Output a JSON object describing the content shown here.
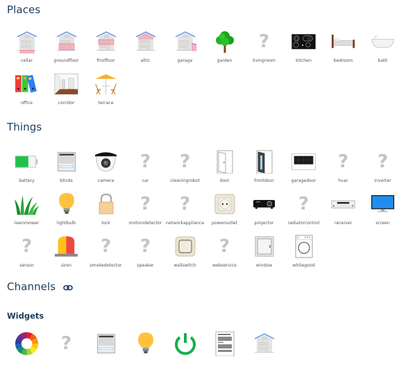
{
  "sections": {
    "places": {
      "title": "Places"
    },
    "things": {
      "title": "Things"
    },
    "channels": {
      "title": "Channels",
      "icon": "link-icon"
    },
    "widgets": {
      "title": "Widgets"
    }
  },
  "places": [
    {
      "label": "cellar",
      "icon": "house-cellar-icon"
    },
    {
      "label": "groundfloor",
      "icon": "house-groundfloor-icon"
    },
    {
      "label": "firstfloor",
      "icon": "house-firstfloor-icon"
    },
    {
      "label": "attic",
      "icon": "house-attic-icon"
    },
    {
      "label": "garage",
      "icon": "house-garage-icon"
    },
    {
      "label": "garden",
      "icon": "tree-icon"
    },
    {
      "label": "livingroom",
      "icon": "question-icon"
    },
    {
      "label": "kitchen",
      "icon": "cooktop-icon"
    },
    {
      "label": "bedroom",
      "icon": "bed-icon"
    },
    {
      "label": "bath",
      "icon": "bathtub-icon"
    },
    {
      "label": "office",
      "icon": "binders-icon"
    },
    {
      "label": "corridor",
      "icon": "corridor-icon"
    },
    {
      "label": "terrace",
      "icon": "terrace-icon"
    }
  ],
  "things": [
    {
      "label": "battery",
      "icon": "battery-icon"
    },
    {
      "label": "blinds",
      "icon": "blinds-icon"
    },
    {
      "label": "camera",
      "icon": "camera-icon"
    },
    {
      "label": "car",
      "icon": "question-icon"
    },
    {
      "label": "cleaningrobot",
      "icon": "question-icon"
    },
    {
      "label": "door",
      "icon": "door-icon"
    },
    {
      "label": "frontdoor",
      "icon": "frontdoor-icon"
    },
    {
      "label": "garagedoor",
      "icon": "garagedoor-icon"
    },
    {
      "label": "hvac",
      "icon": "question-icon"
    },
    {
      "label": "inverter",
      "icon": "question-icon"
    },
    {
      "label": "lawnmower",
      "icon": "grass-icon"
    },
    {
      "label": "lightbulb",
      "icon": "lightbulb-icon"
    },
    {
      "label": "lock",
      "icon": "lock-icon"
    },
    {
      "label": "motiondetector",
      "icon": "question-icon"
    },
    {
      "label": "networkappliance",
      "icon": "question-icon"
    },
    {
      "label": "poweroutlet",
      "icon": "poweroutlet-icon"
    },
    {
      "label": "projector",
      "icon": "projector-icon"
    },
    {
      "label": "radiatorcontrol",
      "icon": "question-icon"
    },
    {
      "label": "receiver",
      "icon": "receiver-icon"
    },
    {
      "label": "screen",
      "icon": "screen-icon"
    },
    {
      "label": "sensor",
      "icon": "question-icon"
    },
    {
      "label": "siren",
      "icon": "siren-icon"
    },
    {
      "label": "smokedetector",
      "icon": "question-icon"
    },
    {
      "label": "speaker",
      "icon": "question-icon"
    },
    {
      "label": "wallswitch",
      "icon": "wallswitch-icon"
    },
    {
      "label": "webservice",
      "icon": "question-icon"
    },
    {
      "label": "window",
      "icon": "window-icon"
    },
    {
      "label": "whitegood",
      "icon": "washingmachine-icon"
    }
  ],
  "widgets": [
    {
      "icon": "colorwheel-icon"
    },
    {
      "icon": "question-icon"
    },
    {
      "icon": "blinds-icon"
    },
    {
      "icon": "lightbulb-icon"
    },
    {
      "icon": "power-icon"
    },
    {
      "icon": "text-document-icon"
    },
    {
      "icon": "house-icon"
    }
  ],
  "glyphs": {
    "question": "?"
  }
}
